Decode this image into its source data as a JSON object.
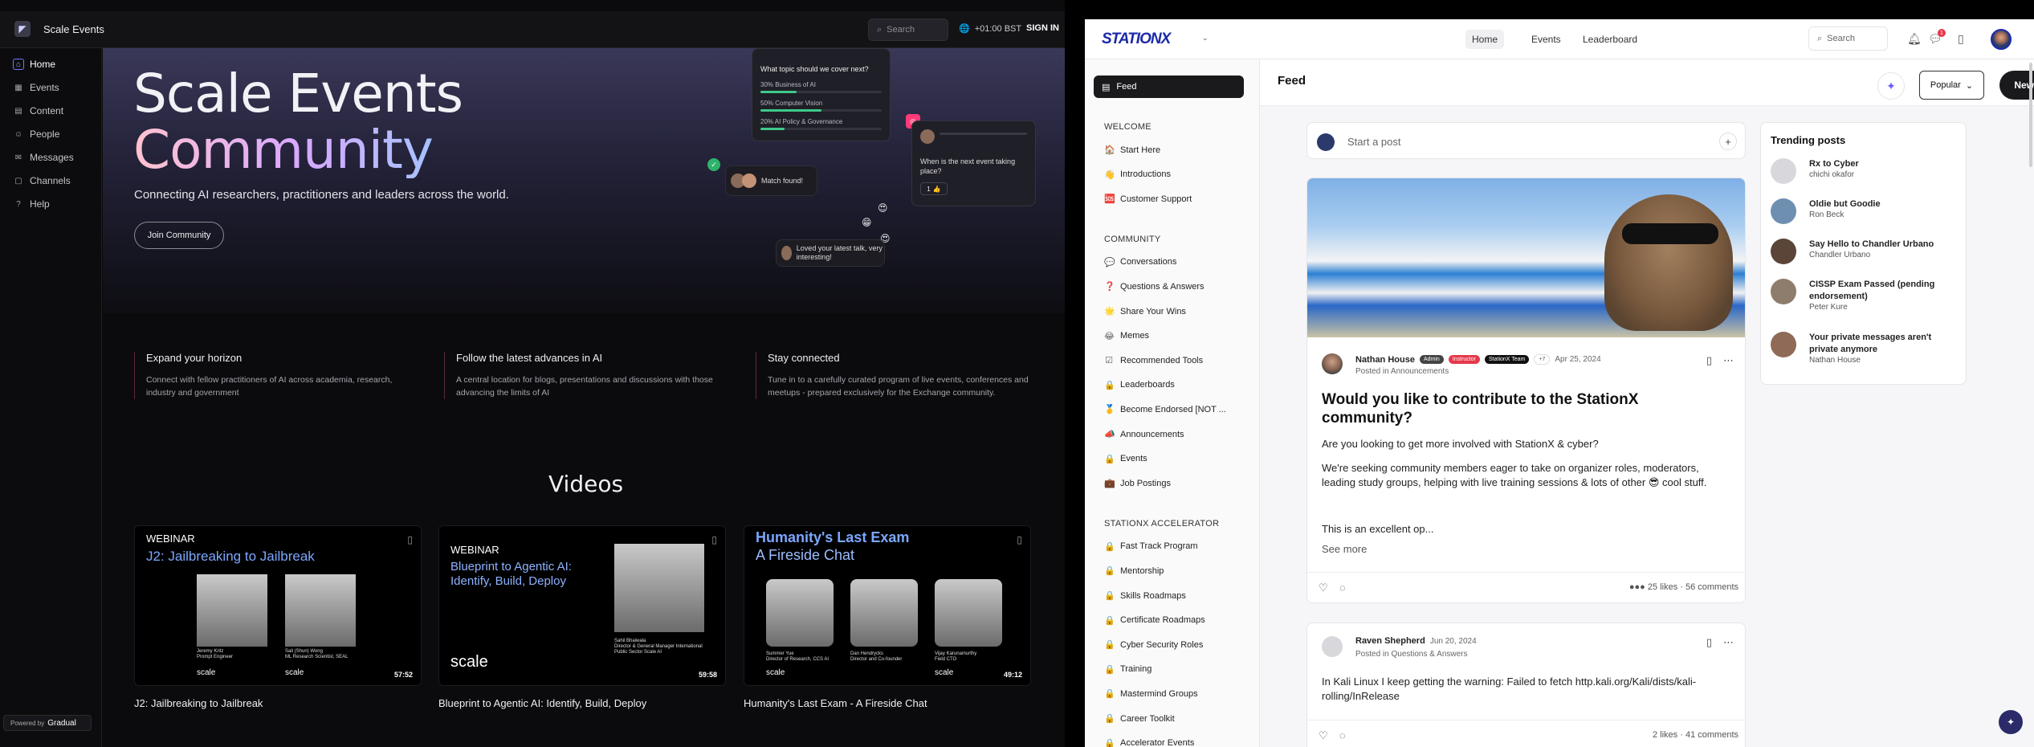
{
  "left": {
    "brand": "Scale Events",
    "search_placeholder": "Search",
    "timezone": "+01:00 BST",
    "signin": "SIGN IN",
    "nav": [
      {
        "label": "Home",
        "icon": "home-icon"
      },
      {
        "label": "Events",
        "icon": "calendar-icon"
      },
      {
        "label": "Content",
        "icon": "content-icon"
      },
      {
        "label": "People",
        "icon": "people-icon"
      },
      {
        "label": "Messages",
        "icon": "messages-icon"
      },
      {
        "label": "Channels",
        "icon": "channels-icon"
      },
      {
        "label": "Help",
        "icon": "help-icon"
      }
    ],
    "powered_by": "Powered by",
    "powered_brand": "Gradual",
    "hero": {
      "title_line1": "Scale Events",
      "title_line2": "Community",
      "subtitle": "Connecting AI researchers, practitioners and leaders across the world.",
      "join": "Join Community",
      "poll_question": "What topic should we cover next?",
      "poll_options": [
        {
          "label": "30% Business of AI",
          "pct": 30
        },
        {
          "label": "50% Computer Vision",
          "pct": 50
        },
        {
          "label": "20% AI Policy & Governance",
          "pct": 20
        }
      ],
      "match_text": "Match found!",
      "event_question": "When is the next event taking place?",
      "event_reply_count": "1",
      "loved_text": "Loved your latest talk, very interesting!"
    },
    "features": [
      {
        "title": "Expand your horizon",
        "desc": "Connect with fellow practitioners of AI across academia, research, industry and government"
      },
      {
        "title": "Follow the latest advances in AI",
        "desc": "A central location for blogs, presentations and discussions with those advancing the limits of AI"
      },
      {
        "title": "Stay connected",
        "desc": "Tune in to a carefully curated program of live events, conferences and meetups - prepared exclusively for the Exchange community."
      }
    ],
    "videos_heading": "Videos",
    "videos": [
      {
        "label": "WEBINAR",
        "title": "J2: Jailbreaking to Jailbreak",
        "brand": "scale",
        "duration": "57:52",
        "caption": "J2: Jailbreaking to Jailbreak",
        "people": [
          {
            "name": "Jeremy Kritz",
            "role": "Prompt Engineer"
          },
          {
            "name": "Sali (Shun) Wong",
            "role": "ML Research Scientist, SEAL"
          }
        ]
      },
      {
        "label": "WEBINAR",
        "title": "Blueprint to Agentic AI: Identify, Build, Deploy",
        "brand": "scale",
        "duration": "59:58",
        "caption": "Blueprint to Agentic AI: Identify, Build, Deploy",
        "people": [
          {
            "name": "Sahil Bhaiwala",
            "role": "Director & General Manager International Public Sector Scale AI"
          }
        ]
      },
      {
        "label": "",
        "title": "Humanity's Last Exam",
        "subtitle": "A Fireside Chat",
        "brand": "scale",
        "duration": "49:12",
        "caption": "Humanity's Last Exam - A Fireside Chat",
        "people": [
          {
            "name": "Summer Yue",
            "role": "Director of Research, CCS AI"
          },
          {
            "name": "Dan Hendrycks",
            "role": "Director and Co-founder"
          },
          {
            "name": "Vijay Karunamurthy",
            "role": "Field CTO"
          }
        ]
      }
    ]
  },
  "right": {
    "logo": "STATIONX",
    "nav": [
      "Home",
      "Events",
      "Leaderboard"
    ],
    "search_placeholder": "Search",
    "notif_count": "1",
    "feed_label": "Feed",
    "sections": [
      {
        "title": "WELCOME",
        "items": [
          {
            "label": "Start Here",
            "icon": "🏠"
          },
          {
            "label": "Introductions",
            "icon": "👋"
          },
          {
            "label": "Customer Support",
            "icon": "🆘"
          }
        ]
      },
      {
        "title": "COMMUNITY",
        "items": [
          {
            "label": "Conversations",
            "icon": "💬"
          },
          {
            "label": "Questions & Answers",
            "icon": "❓"
          },
          {
            "label": "Share Your Wins",
            "icon": "🌟"
          },
          {
            "label": "Memes",
            "icon": "😂"
          },
          {
            "label": "Recommended Tools",
            "icon": "☑"
          },
          {
            "label": "Leaderboards",
            "icon": "🔒"
          },
          {
            "label": "Become Endorsed [NOT ...",
            "icon": "🥇"
          },
          {
            "label": "Announcements",
            "icon": "📣"
          },
          {
            "label": "Events",
            "icon": "🔒"
          },
          {
            "label": "Job Postings",
            "icon": "💼"
          }
        ]
      },
      {
        "title": "STATIONX ACCELERATOR",
        "items": [
          {
            "label": "Fast Track Program",
            "icon": "🔒"
          },
          {
            "label": "Mentorship",
            "icon": "🔒"
          },
          {
            "label": "Skills Roadmaps",
            "icon": "🔒"
          },
          {
            "label": "Certificate Roadmaps",
            "icon": "🔒"
          },
          {
            "label": "Cyber Security Roles",
            "icon": "🔒"
          },
          {
            "label": "Training",
            "icon": "🔒"
          },
          {
            "label": "Mastermind Groups",
            "icon": "🔒"
          },
          {
            "label": "Career Toolkit",
            "icon": "🔒"
          },
          {
            "label": "Accelerator Events",
            "icon": "🔒"
          }
        ]
      }
    ],
    "feed_title": "Feed",
    "sort": "Popular",
    "new_post": "New post",
    "start_post": "Start a post",
    "post1": {
      "author": "Nathan House",
      "tags": [
        "Admin",
        "Instructor",
        "StationX Team",
        "+7"
      ],
      "date": "Apr 25, 2024",
      "posted_in": "Posted in Announcements",
      "title": "Would you like to contribute to the StationX community?",
      "body1": "Are you looking to get more involved with StationX & cyber?",
      "body2": "We're seeking community members eager to take on organizer roles, moderators, leading study groups, helping with live training sessions & lots of other 😎 cool stuff.",
      "body3": "This is an excellent op...",
      "see_more": "See more",
      "likes": "25 likes",
      "comments": "56 comments"
    },
    "post2": {
      "author": "Raven Shepherd",
      "date": "Jun 20, 2024",
      "posted_in": "Posted in Questions & Answers",
      "body": "In Kali Linux I keep getting the warning: Failed to fetch http.kali.org/Kali/dists/kali-rolling/InRelease",
      "likes": "2 likes",
      "comments": "41 comments"
    },
    "trending_title": "Trending posts",
    "trending": [
      {
        "title": "Rx to Cyber",
        "author": "chichi okafor"
      },
      {
        "title": "Oldie but Goodie",
        "author": "Ron Beck"
      },
      {
        "title": "Say Hello to Chandler Urbano",
        "author": "Chandler Urbano"
      },
      {
        "title": "CISSP Exam Passed (pending endorsement)",
        "author": "Peter Kure"
      },
      {
        "title": "Your private messages aren't private anymore",
        "author": "Nathan House"
      }
    ]
  }
}
